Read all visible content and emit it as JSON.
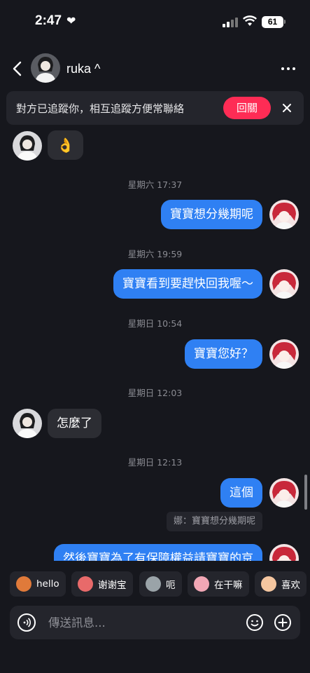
{
  "status": {
    "time": "2:47",
    "battery": "61"
  },
  "header": {
    "name": "ruka ^"
  },
  "banner": {
    "text": "對方已追蹤你，相互追蹤方便常聯絡",
    "button": "回關"
  },
  "messages": {
    "m1_emoji": "👌",
    "ts1": "星期六 17:37",
    "m2": "寶寶想分幾期呢",
    "ts2": "星期六 19:59",
    "m3": "寶寶看到要趕快回我喔～",
    "ts3": "星期日 10:54",
    "m4": "寶寶您好？",
    "ts4": "星期日 12:03",
    "m5": "怎麼了",
    "ts5": "星期日 12:13",
    "m6": "這個",
    "quote": "娜：寶寶想分幾期呢",
    "m7": "然後寶寶為了有保障權益請寶寶的京"
  },
  "quick_replies": [
    {
      "label": "hello",
      "icon": "monkey-face-icon",
      "color": "#e07a3a"
    },
    {
      "label": "谢谢宝",
      "icon": "cartoon-face-icon",
      "color": "#e86a6a"
    },
    {
      "label": "呃",
      "icon": "cat-face-icon",
      "color": "#9aa3a8"
    },
    {
      "label": "在干嘛",
      "icon": "cartoon-face-icon",
      "color": "#f2a7b5"
    },
    {
      "label": "喜欢",
      "icon": "cartoon-face-icon",
      "color": "#f5c6a0"
    }
  ],
  "input": {
    "placeholder": "傳送訊息..."
  },
  "colors": {
    "accent_blue": "#2f80f3",
    "follow_red": "#fe2c55",
    "background": "#16171d"
  }
}
